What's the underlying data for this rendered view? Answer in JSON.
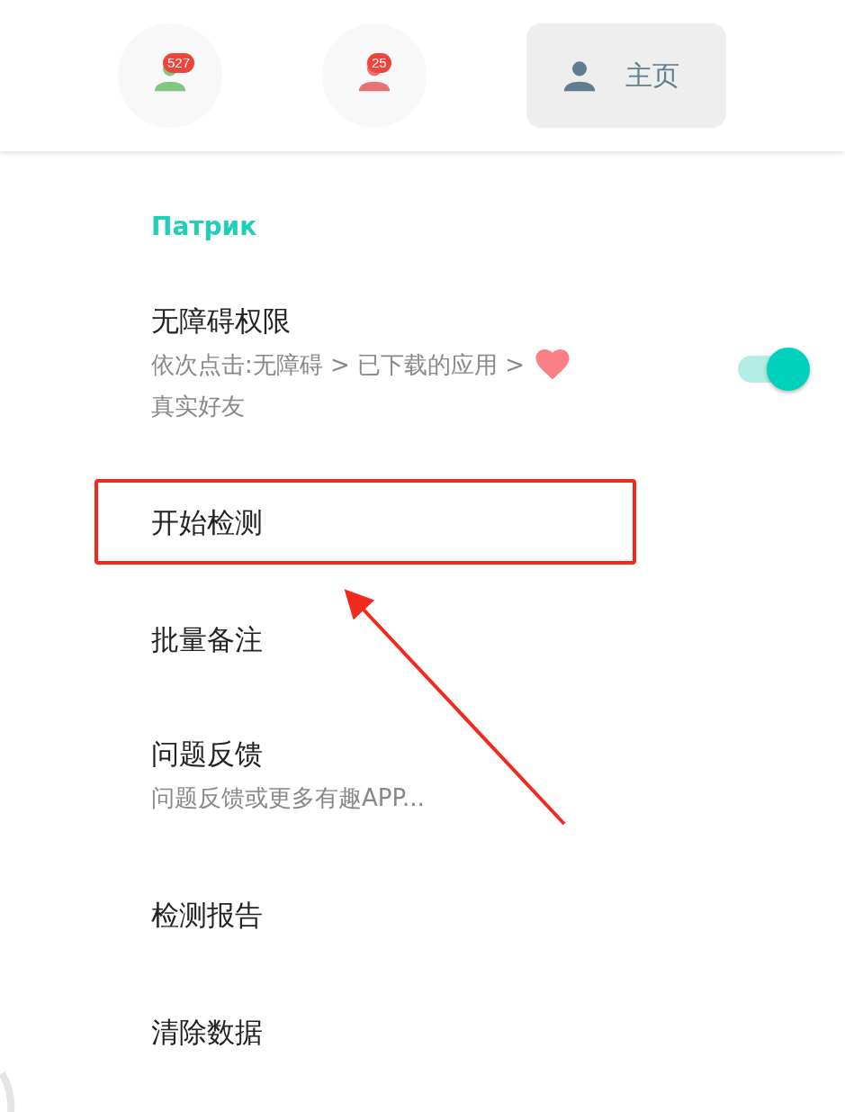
{
  "nav": [
    {
      "kind": "counter",
      "badge": "527",
      "color": "#81c784"
    },
    {
      "kind": "counter",
      "badge": "25",
      "color": "#e57373"
    },
    {
      "kind": "home",
      "label": "主页",
      "color": "#5f7d8e"
    }
  ],
  "section_title": "Патрик",
  "items": [
    {
      "kind": "toggle",
      "title": "无障碍权限",
      "subtitle": "依次点击:无障碍 > 已下载的应用 >",
      "subtitle_end": "真实好友",
      "on": true,
      "highlighted": false
    },
    {
      "kind": "plain",
      "title": "开始检测",
      "highlighted": true
    },
    {
      "kind": "plain",
      "title": "批量备注",
      "highlighted": false
    },
    {
      "kind": "plain",
      "title": "问题反馈",
      "subtitle": "问题反馈或更多有趣APP...",
      "highlighted": false
    },
    {
      "kind": "plain",
      "title": "检测报告",
      "highlighted": false
    },
    {
      "kind": "plain",
      "title": "清除数据",
      "highlighted": false
    }
  ]
}
